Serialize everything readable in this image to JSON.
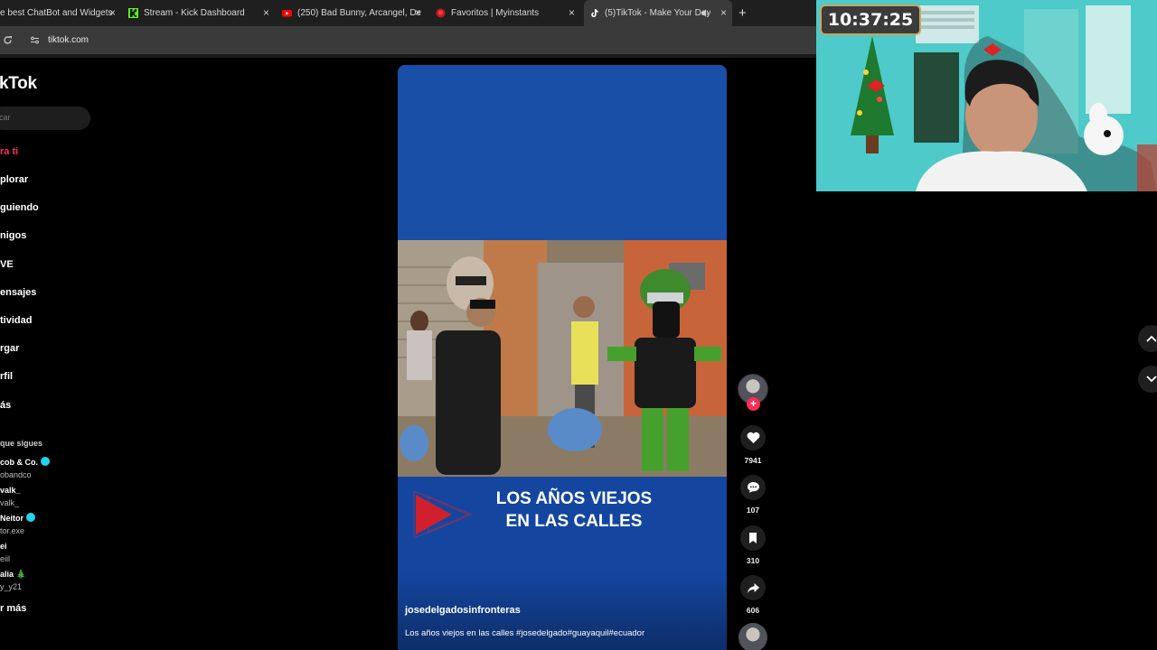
{
  "browser": {
    "tabs": [
      {
        "title": "e best ChatBot and Widgets",
        "favicon_color": "#6a6a6a"
      },
      {
        "title": "Stream - Kick Dashboard",
        "favicon_color": "#53fc18"
      },
      {
        "title": "(250) Bad Bunny, Arcangel, De",
        "favicon_color": "#ff0000"
      },
      {
        "title": "Favoritos | Myinstants",
        "favicon_color": "#e02020"
      },
      {
        "title": "(5)TikTok - Make Your Day",
        "favicon_color": "#ffffff",
        "active": true
      }
    ],
    "close_glyph": "×",
    "new_tab_glyph": "+",
    "url": "tiktok.com"
  },
  "sidebar": {
    "logo": "kTok",
    "search_placeholder": "car",
    "nav": [
      {
        "label": "ra ti",
        "active": true
      },
      {
        "label": "plorar"
      },
      {
        "label": "guiendo"
      },
      {
        "label": "nigos"
      },
      {
        "label": "VE"
      },
      {
        "label": "ensajes"
      },
      {
        "label": "tividad"
      },
      {
        "label": "rgar"
      },
      {
        "label": "rfil"
      },
      {
        "label": "ás"
      }
    ],
    "following_title": "que sigues",
    "accounts": [
      {
        "name": "cob & Co.",
        "handle": "obandco",
        "verified": true
      },
      {
        "name": "valk_",
        "handle": "valk_",
        "verified": false
      },
      {
        "name": "Neitor",
        "handle": "tor.exe",
        "verified": true
      },
      {
        "name": "ei",
        "handle": "eiil",
        "verified": false
      },
      {
        "name": "alia 🎄",
        "handle": "y_y21",
        "verified": false
      }
    ],
    "see_more": "r más"
  },
  "video": {
    "overlay_line1": "LOS AÑOS VIEJOS",
    "overlay_line2": "EN LAS CALLES",
    "author": "josedelgadosinfronteras",
    "caption": "Los años viejos en las calles #josedelgado#guayaquil#ecuador"
  },
  "actions": {
    "follow_glyph": "+",
    "likes": "7941",
    "comments": "107",
    "saves": "310",
    "shares": "606"
  },
  "webcam": {
    "clock": "10:37:25"
  },
  "colors": {
    "accent": "#fe2c55",
    "video_blue": "#1446a0"
  }
}
